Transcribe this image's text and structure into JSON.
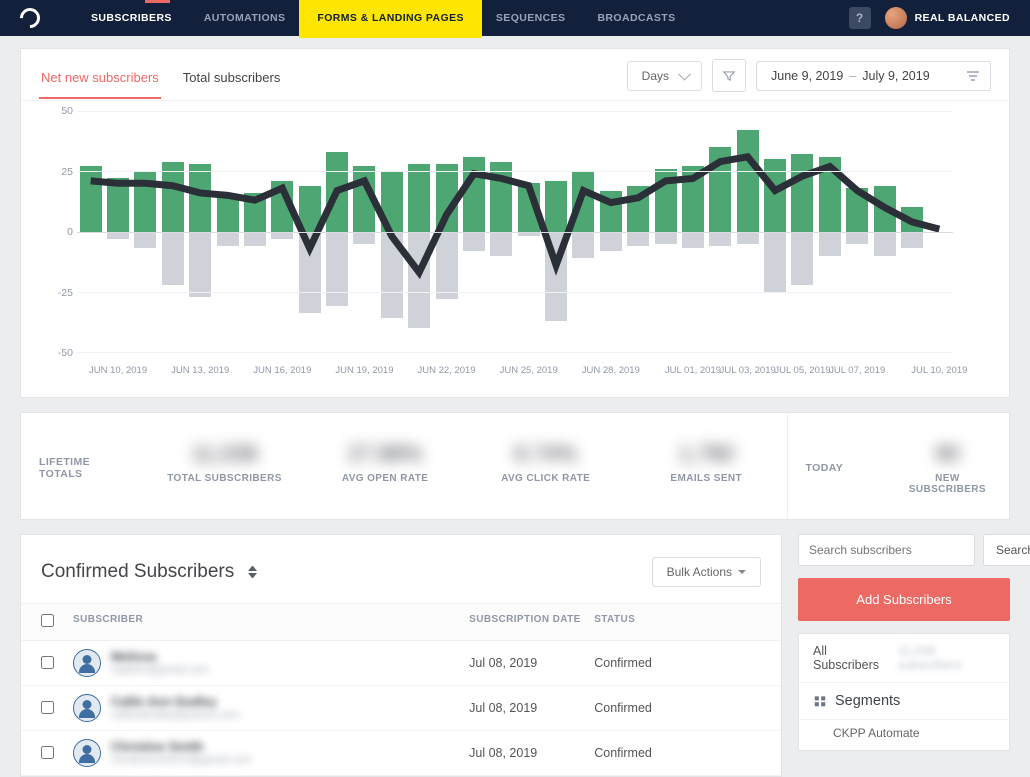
{
  "nav": {
    "items": [
      "SUBSCRIBERS",
      "AUTOMATIONS",
      "FORMS & LANDING PAGES",
      "SEQUENCES",
      "BROADCASTS"
    ],
    "active_index": 0,
    "highlight_index": 2
  },
  "topbar": {
    "help": "?",
    "account_name": "REAL BALANCED"
  },
  "tabs": {
    "items": [
      "Net new subscribers",
      "Total subscribers"
    ],
    "active_index": 0
  },
  "controls": {
    "granularity": "Days",
    "date_from": "June 9, 2019",
    "date_to": "July 9, 2019"
  },
  "totals": {
    "lifetime_label": "LIFETIME TOTALS",
    "items": [
      {
        "value": "11,038",
        "caption": "TOTAL SUBSCRIBERS"
      },
      {
        "value": "27.88%",
        "caption": "AVG OPEN RATE"
      },
      {
        "value": "6.74%",
        "caption": "AVG CLICK RATE"
      },
      {
        "value": "1,780",
        "caption": "EMAILS SENT"
      }
    ],
    "today_label": "TODAY",
    "today": {
      "value": "90",
      "caption": "NEW SUBSCRIBERS"
    }
  },
  "table": {
    "title": "Confirmed Subscribers",
    "bulk_label": "Bulk Actions",
    "columns": [
      "SUBSCRIBER",
      "SUBSCRIPTION DATE",
      "STATUS"
    ],
    "rows": [
      {
        "name": "Melissa",
        "email": "mjather@gmail.com",
        "date": "Jul 08, 2019",
        "status": "Confirmed"
      },
      {
        "name": "Callie Ann Dudley",
        "email": "callieadudley@yahoo.com",
        "date": "Jul 08, 2019",
        "status": "Confirmed"
      },
      {
        "name": "Christine Smith",
        "email": "christinesmith15@gmail.com",
        "date": "Jul 08, 2019",
        "status": "Confirmed"
      }
    ]
  },
  "sidebar": {
    "search_placeholder": "Search subscribers",
    "search_btn": "Search",
    "add_btn": "Add Subscribers",
    "all_subs": "All Subscribers",
    "all_subs_count": "11,038 subscribers",
    "segments_label": "Segments",
    "segments": [
      "CKPP Automate"
    ]
  },
  "chart_data": {
    "type": "bar+line",
    "title": "",
    "ylabel": "",
    "ylim": [
      -50,
      50
    ],
    "y_ticks": [
      -50,
      -25,
      0,
      25,
      50
    ],
    "categories": [
      "Jun 09",
      "Jun 10",
      "Jun 11",
      "Jun 12",
      "Jun 13",
      "Jun 14",
      "Jun 15",
      "Jun 16",
      "Jun 17",
      "Jun 18",
      "Jun 19",
      "Jun 20",
      "Jun 21",
      "Jun 22",
      "Jun 23",
      "Jun 24",
      "Jun 25",
      "Jun 26",
      "Jun 27",
      "Jun 28",
      "Jun 29",
      "Jun 30",
      "Jul 01",
      "Jul 02",
      "Jul 03",
      "Jul 04",
      "Jul 05",
      "Jul 06",
      "Jul 07",
      "Jul 08",
      "Jul 09",
      "Jul 10"
    ],
    "x_tick_labels": [
      "JUN 10, 2019",
      "JUN 13, 2019",
      "JUN 16, 2019",
      "JUN 19, 2019",
      "JUN 22, 2019",
      "JUN 25, 2019",
      "JUN 28, 2019",
      "JUL 01, 2019",
      "JUL 03, 2019",
      "JUL 05, 2019",
      "JUL 07, 2019",
      "JUL 10, 2019"
    ],
    "x_tick_positions": [
      1,
      4,
      7,
      10,
      13,
      16,
      19,
      22,
      24,
      26,
      28,
      31
    ],
    "series": [
      {
        "name": "gains",
        "role": "bar_pos",
        "values": [
          27,
          22,
          25,
          29,
          28,
          15,
          16,
          21,
          19,
          33,
          27,
          25,
          28,
          28,
          31,
          29,
          20,
          21,
          25,
          17,
          19,
          26,
          27,
          35,
          42,
          30,
          32,
          31,
          18,
          19,
          10,
          0
        ]
      },
      {
        "name": "losses",
        "role": "bar_neg",
        "values": [
          0,
          -3,
          -7,
          -22,
          -27,
          -6,
          -6,
          -3,
          -34,
          -31,
          -5,
          -36,
          -40,
          -28,
          -8,
          -10,
          -2,
          -37,
          -11,
          -8,
          -6,
          -5,
          -7,
          -6,
          -5,
          -25,
          -22,
          -10,
          -5,
          -10,
          -7,
          0
        ]
      },
      {
        "name": "net",
        "role": "line",
        "values": [
          21,
          20,
          20,
          19,
          16,
          15,
          13,
          18,
          -7,
          17,
          21,
          -2,
          -17,
          7,
          24,
          22,
          19,
          -14,
          17,
          12,
          14,
          21,
          22,
          29,
          31,
          17,
          23,
          27,
          17,
          10,
          4,
          1
        ]
      }
    ]
  }
}
